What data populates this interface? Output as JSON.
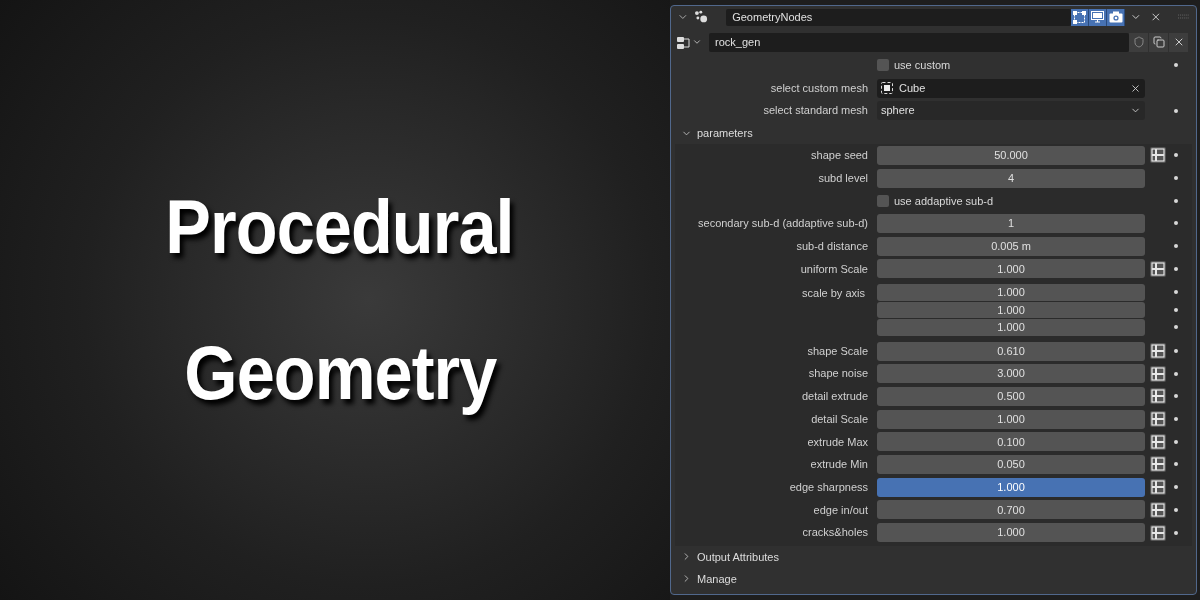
{
  "title": {
    "lines": [
      "Procedural",
      "Geometry"
    ]
  },
  "modifier": {
    "name": "GeometryNodes",
    "expanded": true,
    "toggles": [
      {
        "kind": "editmode",
        "on": true
      },
      {
        "kind": "viewport",
        "on": true
      },
      {
        "kind": "render",
        "on": true
      }
    ]
  },
  "node_group": {
    "name": "rock_gen"
  },
  "inputs": [
    {
      "kind": "checkbox",
      "label": "use custom",
      "checked": false,
      "animatable": true
    },
    {
      "kind": "object",
      "label": "select custom mesh",
      "value": "Cube",
      "animatable": false
    },
    {
      "kind": "menu",
      "label": "select standard mesh",
      "value": "sphere",
      "animatable": true
    }
  ],
  "parameters": {
    "label": "parameters",
    "expanded": true,
    "rows": [
      {
        "kind": "number",
        "label": "shape seed",
        "value": "50.000",
        "attribute_toggle": true,
        "selected": false
      },
      {
        "kind": "number",
        "label": "subd level",
        "value": "4",
        "attribute_toggle": false,
        "selected": false
      },
      {
        "kind": "checkbox",
        "label": "use addaptive sub-d",
        "checked": false
      },
      {
        "kind": "number",
        "label": "secondary sub-d (addaptive sub-d)",
        "value": "1",
        "attribute_toggle": false,
        "selected": false
      },
      {
        "kind": "number",
        "label": "sub-d distance",
        "value": "0.005 m",
        "attribute_toggle": false,
        "selected": false
      },
      {
        "kind": "number",
        "label": "uniform Scale",
        "value": "1.000",
        "attribute_toggle": true,
        "selected": false
      },
      {
        "kind": "vector",
        "label": "scale by axis",
        "values": [
          "1.000",
          "1.000",
          "1.000"
        ]
      },
      {
        "kind": "number",
        "label": "shape Scale",
        "value": "0.610",
        "attribute_toggle": true,
        "selected": false
      },
      {
        "kind": "number",
        "label": "shape noise",
        "value": "3.000",
        "attribute_toggle": true,
        "selected": false
      },
      {
        "kind": "number",
        "label": "detail extrude",
        "value": "0.500",
        "attribute_toggle": true,
        "selected": false
      },
      {
        "kind": "number",
        "label": "detail Scale",
        "value": "1.000",
        "attribute_toggle": true,
        "selected": false
      },
      {
        "kind": "number",
        "label": "extrude Max",
        "value": "0.100",
        "attribute_toggle": true,
        "selected": false
      },
      {
        "kind": "number",
        "label": "extrude Min",
        "value": "0.050",
        "attribute_toggle": true,
        "selected": false
      },
      {
        "kind": "number",
        "label": "edge sharpness",
        "value": "1.000",
        "attribute_toggle": true,
        "selected": true
      },
      {
        "kind": "number",
        "label": "edge in/out",
        "value": "0.700",
        "attribute_toggle": true,
        "selected": false
      },
      {
        "kind": "number",
        "label": "cracks&holes",
        "value": "1.000",
        "attribute_toggle": true,
        "selected": false
      }
    ]
  },
  "sections": [
    {
      "label": "Output Attributes",
      "expanded": false
    },
    {
      "label": "Manage",
      "expanded": false
    }
  ]
}
